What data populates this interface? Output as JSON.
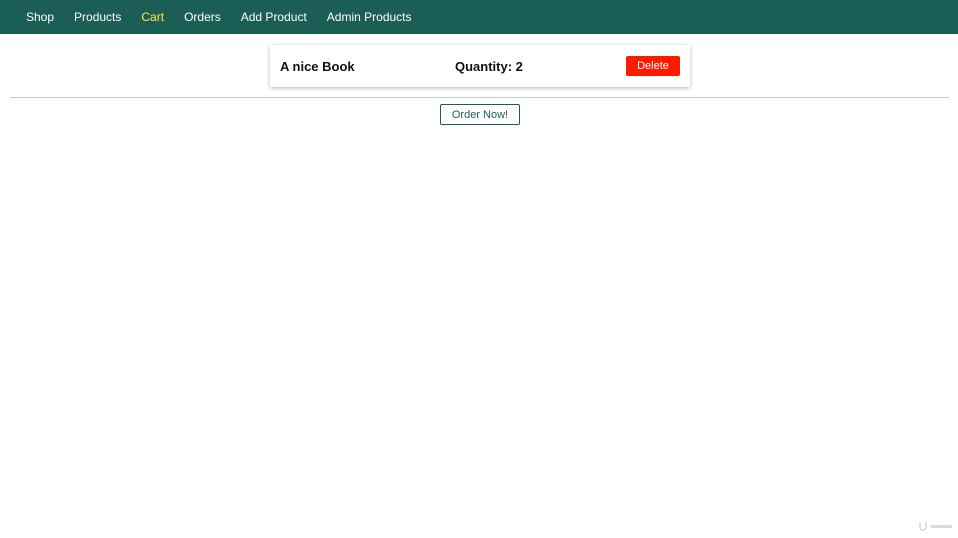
{
  "nav": {
    "items": [
      {
        "label": "Shop"
      },
      {
        "label": "Products"
      },
      {
        "label": "Cart",
        "active": true
      },
      {
        "label": "Orders"
      },
      {
        "label": "Add Product"
      },
      {
        "label": "Admin Products"
      }
    ]
  },
  "cart": {
    "items": [
      {
        "title": "A nice Book",
        "quantity_text": "Quantity: 2",
        "delete_label": "Delete"
      }
    ],
    "order_button_label": "Order Now!"
  },
  "colors": {
    "header_bg": "#1b5e56",
    "active_nav": "#ffeb3b",
    "delete_bg": "#ff1a00",
    "accent": "#1b5e56"
  },
  "icons": {
    "watermark": "udemy-logo-icon"
  }
}
